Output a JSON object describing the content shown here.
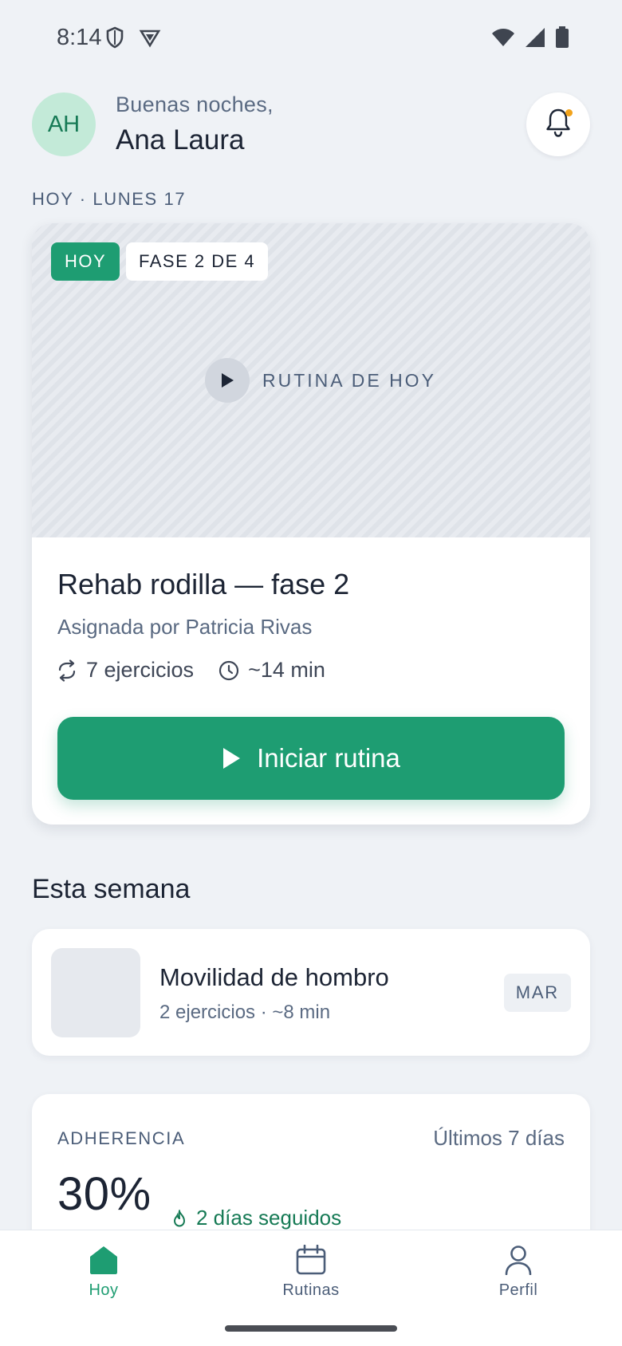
{
  "status_bar": {
    "time": "8:14",
    "icons": [
      "shield-icon",
      "vpn-icon",
      "wifi-icon",
      "cell-signal-icon",
      "battery-icon"
    ]
  },
  "header": {
    "avatar_initials": "AH",
    "greeting": "Buenas noches,",
    "user_name": "Ana Laura",
    "notification_dot": true
  },
  "date_label": "HOY · LUNES 17",
  "today_card": {
    "badge_today": "HOY",
    "badge_phase": "FASE 2 DE 4",
    "media_caption": "RUTINA DE HOY",
    "title": "Rehab rodilla — fase 2",
    "assigned_by": "Asignada por Patricia Rivas",
    "exercises": "7 ejercicios",
    "duration": "~14 min",
    "start_button": "Iniciar rutina"
  },
  "this_week": {
    "title": "Esta semana",
    "items": [
      {
        "title": "Movilidad de hombro",
        "subtitle": "2 ejercicios · ~8 min",
        "day": "MAR"
      }
    ]
  },
  "adherence": {
    "label": "ADHERENCIA",
    "range": "Últimos 7 días",
    "value": "30%",
    "streak": "2 días seguidos"
  },
  "bottom_nav": {
    "items": [
      {
        "label": "Hoy",
        "icon": "home-icon",
        "active": true
      },
      {
        "label": "Rutinas",
        "icon": "calendar-icon",
        "active": false
      },
      {
        "label": "Perfil",
        "icon": "user-icon",
        "active": false
      }
    ]
  },
  "colors": {
    "accent": "#1e9d72",
    "background": "#eff2f6",
    "notification": "#f2a31b"
  }
}
